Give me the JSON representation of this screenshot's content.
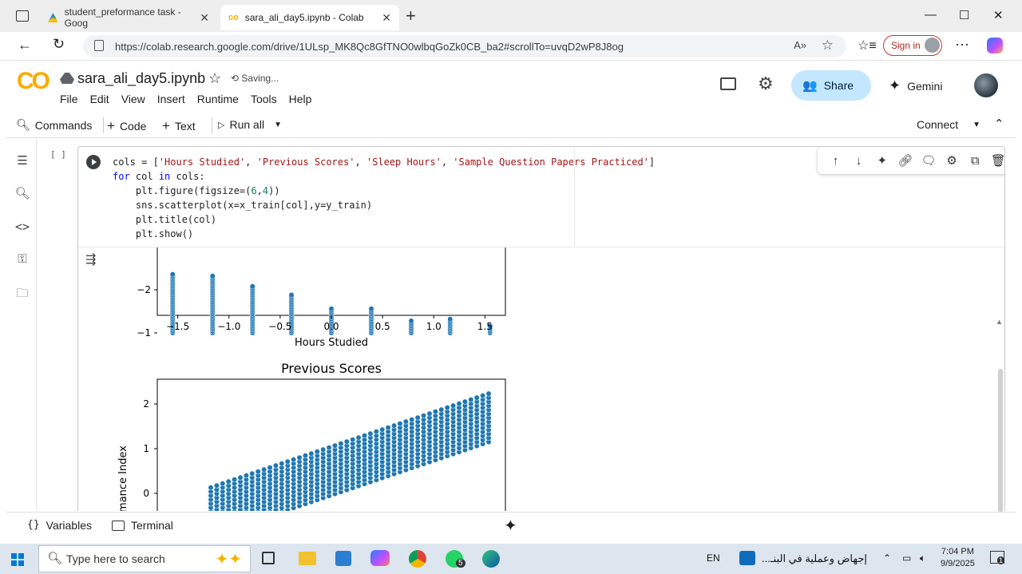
{
  "browser": {
    "tabs": [
      {
        "title": "student_preformance task - Goog",
        "close": "✕"
      },
      {
        "title": "sara_ali_day5.ipynb - Colab",
        "close": "✕"
      }
    ],
    "new_tab": "+",
    "url": "https://colab.research.google.com/drive/1ULsp_MK8Qc8GfTNO0wlbqGoZk0CB_ba2#scrollTo=uvqD2wP8J8og",
    "sign_in": "Sign in",
    "window": {
      "minimize": "—",
      "maximize": "☐",
      "close": "✕"
    }
  },
  "colab": {
    "logo": "CO",
    "title": "sara_ali_day5.ipynb",
    "status": "Saving...",
    "menu": [
      "File",
      "Edit",
      "View",
      "Insert",
      "Runtime",
      "Tools",
      "Help"
    ],
    "share_label": "Share",
    "gemini_label": "Gemini"
  },
  "toolbar": {
    "commands": "Commands",
    "code": "Code",
    "text": "Text",
    "run_all": "Run all",
    "connect": "Connect"
  },
  "cell": {
    "exec_count": "[ ]",
    "code_lines": [
      "cols = ['Hours Studied', 'Previous Scores', 'Sleep Hours', 'Sample Question Papers Practiced']",
      "for col in cols:",
      "    plt.figure(figsize=(6,4))",
      "    sns.scatterplot(x=x_train[col],y=y_train)",
      "    plt.title(col)",
      "    plt.show()"
    ]
  },
  "chart_data": [
    {
      "type": "scatter",
      "title": "",
      "xlabel": "Hours Studied",
      "ylabel": "",
      "xlim": [
        -1.7,
        1.7
      ],
      "x_ticks": [
        "−1.5",
        "−1.0",
        "−0.5",
        "0.0",
        "0.5",
        "1.0",
        "1.5"
      ],
      "y_ticks": [
        "−1",
        "−2"
      ],
      "x_values": [
        -1.55,
        -1.16,
        -0.77,
        -0.39,
        0.0,
        0.39,
        0.78,
        1.16,
        1.55
      ],
      "y_ranges": [
        [
          -2.4,
          -1.0
        ],
        [
          -2.35,
          -1.0
        ],
        [
          -2.1,
          -1.0
        ],
        [
          -1.9,
          -1.0
        ],
        [
          -1.6,
          -1.0
        ],
        [
          -1.6,
          -1.0
        ],
        [
          -1.3,
          -1.0
        ],
        [
          -1.35,
          -1.0
        ],
        [
          -1.2,
          -1.0
        ]
      ],
      "color": "#1f77b4"
    },
    {
      "type": "scatter",
      "title": "Previous Scores",
      "xlabel": "",
      "ylabel": "mance Index",
      "y_ticks": [
        "2",
        "1",
        "0"
      ],
      "trend": "positive linear, y from about -0.4 at left to 2.3 at right",
      "color": "#1f77b4"
    }
  ],
  "bottom": {
    "variables": "Variables",
    "terminal": "Terminal"
  },
  "taskbar": {
    "search": "Type here to search",
    "lang": "EN",
    "notification_text": "إجهاض وعملية في البنـ...",
    "time": "7:04 PM",
    "date": "9/9/2025",
    "whatsapp_badge": "5",
    "notif_badge": "1"
  }
}
